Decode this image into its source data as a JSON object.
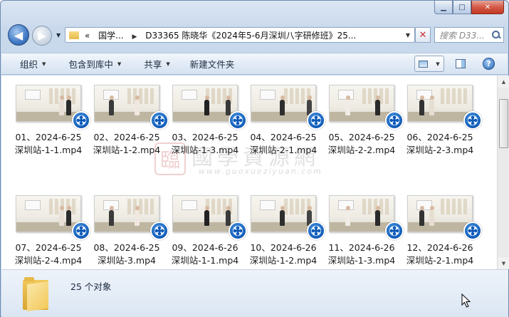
{
  "window": {
    "caption": {
      "minimize": "▁",
      "maximize": "□",
      "close": "✕"
    }
  },
  "nav": {
    "back_icon": "arrow-left-icon",
    "forward_icon": "arrow-right-icon",
    "breadcrumb_overflow": "«",
    "breadcrumb": [
      "国学...",
      "D33365 陈晓华《2024年5-6月深圳八字研修班》25..."
    ],
    "search_placeholder": "搜索 D33..."
  },
  "toolbar": {
    "organize": "组织",
    "include_library": "包含到库中",
    "share": "共享",
    "new_folder": "新建文件夹"
  },
  "files": [
    {
      "line1": "01、2024-6-25",
      "line2": "深圳站-1-1.mp4"
    },
    {
      "line1": "02、2024-6-25",
      "line2": "深圳站-1-2.mp4"
    },
    {
      "line1": "03、2024-6-25",
      "line2": "深圳站-1-3.mp4"
    },
    {
      "line1": "04、2024-6-25",
      "line2": "深圳站-2-1.mp4"
    },
    {
      "line1": "05、2024-6-25",
      "line2": "深圳站-2-2.mp4"
    },
    {
      "line1": "06、2024-6-25",
      "line2": "深圳站-2-3.mp4"
    },
    {
      "line1": "07、2024-6-25",
      "line2": "深圳站-2-4.mp4"
    },
    {
      "line1": "08、2024-6-25",
      "line2": "深圳站-3.mp4"
    },
    {
      "line1": "09、2024-6-26",
      "line2": "深圳站-1-1.mp4"
    },
    {
      "line1": "10、2024-6-26",
      "line2": "深圳站-1-2.mp4"
    },
    {
      "line1": "11、2024-6-26",
      "line2": "深圳站-1-3.mp4"
    },
    {
      "line1": "12、2024-6-26",
      "line2": "深圳站-2-1.mp4"
    }
  ],
  "watermark": {
    "logo": "臨",
    "text": "國學資源網",
    "url": "www.guoxueziyuan.com"
  },
  "details": {
    "count": "25 个对象"
  }
}
